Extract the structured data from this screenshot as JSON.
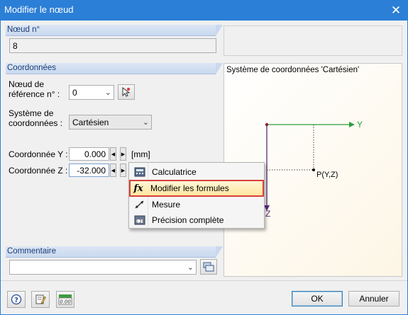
{
  "window": {
    "title": "Modifier le nœud"
  },
  "node_group": {
    "header": "Nœud n°",
    "value": "8"
  },
  "coords_group": {
    "header": "Coordonnées",
    "ref_node_label_line1": "Nœud de",
    "ref_node_label_line2": "référence n° :",
    "ref_node_value": "0",
    "system_label_line1": "Système de",
    "system_label_line2": "coordonnées :",
    "system_value": "Cartésien",
    "y_label": "Coordonnée Y :",
    "y_value": "0.000",
    "y_unit": "[mm]",
    "z_label": "Coordonnée Z :",
    "z_value": "-32.000"
  },
  "context_menu": {
    "items": [
      {
        "label": "Calculatrice",
        "icon": "calculator-icon"
      },
      {
        "label": "Modifier les formules",
        "icon": "fx-icon",
        "highlighted": true
      },
      {
        "label": "Mesure",
        "icon": "measure-icon"
      },
      {
        "label": "Précision complète",
        "icon": "precision-icon"
      }
    ]
  },
  "preview": {
    "title": "Système de coordonnées 'Cartésien'",
    "axis_y": "Y",
    "axis_z": "Z",
    "point_label": "P(Y,Z)"
  },
  "comment_group": {
    "header": "Commentaire",
    "value": ""
  },
  "footer": {
    "ok_label": "OK",
    "cancel_label": "Annuler"
  },
  "colors": {
    "titlebar": "#2b7fd6",
    "axis_y": "#2e9e3e",
    "highlight_border": "#d9403a"
  }
}
